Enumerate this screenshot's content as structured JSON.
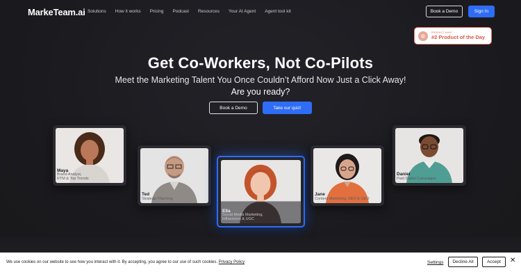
{
  "nav": {
    "logo": "MarkeTeam.ai",
    "links": [
      "Solutions",
      "How it works",
      "Pricing",
      "Podcast",
      "Resources",
      "Your AI Agent",
      "Agent tool kit"
    ],
    "book_demo": "Book a Demo",
    "sign_in": "Sign In"
  },
  "badge": {
    "small": "Product Hunt",
    "big": "#2 Product of the Day"
  },
  "hero": {
    "title": "Get Co-Workers, Not Co-Pilots",
    "subtitle": "Meet the Marketing Talent You Once Couldn’t Afford Now Just a Click Away!",
    "question": "Are you ready?",
    "book_demo": "Book a Demo",
    "quiz": "Take our quiz!"
  },
  "agents": [
    {
      "name": "Maya",
      "role": "Brand Analyst,\nRTM & Top Trends"
    },
    {
      "name": "Ted",
      "role": "Strategic Planning"
    },
    {
      "name": "Ella",
      "role": "Social Media Marketing,\nInfluencers & UGC"
    },
    {
      "name": "Jane",
      "role": "Content Marketing, SEO & GEO"
    },
    {
      "name": "Daniel",
      "role": "Paid Digital Campaigns"
    }
  ],
  "cookie": {
    "text": "We use cookies on our website to see how you interact with it. By accepting, you agree to our use of such cookies.",
    "policy": "Privacy Policy",
    "settings": "Settings",
    "decline": "Decline All",
    "accept": "Accept",
    "close": "✕"
  },
  "colors": {
    "accent": "#2f6df6",
    "background": "#1b1b1f",
    "badge": "#d65a48"
  }
}
